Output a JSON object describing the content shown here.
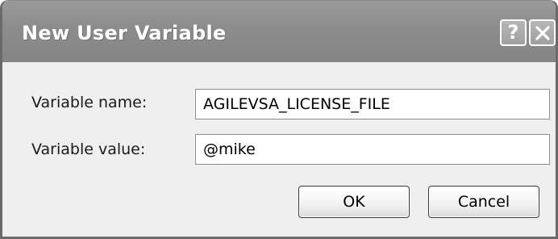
{
  "window": {
    "title": "New User Variable",
    "help_glyph": "?",
    "help_icon": "help-icon",
    "close_icon": "close-icon"
  },
  "form": {
    "name_label": "Variable name:",
    "name_value": "AGILEVSA_LICENSE_FILE",
    "value_label": "Variable value:",
    "value_value": "@mike"
  },
  "buttons": {
    "ok_label": "OK",
    "cancel_label": "Cancel"
  }
}
